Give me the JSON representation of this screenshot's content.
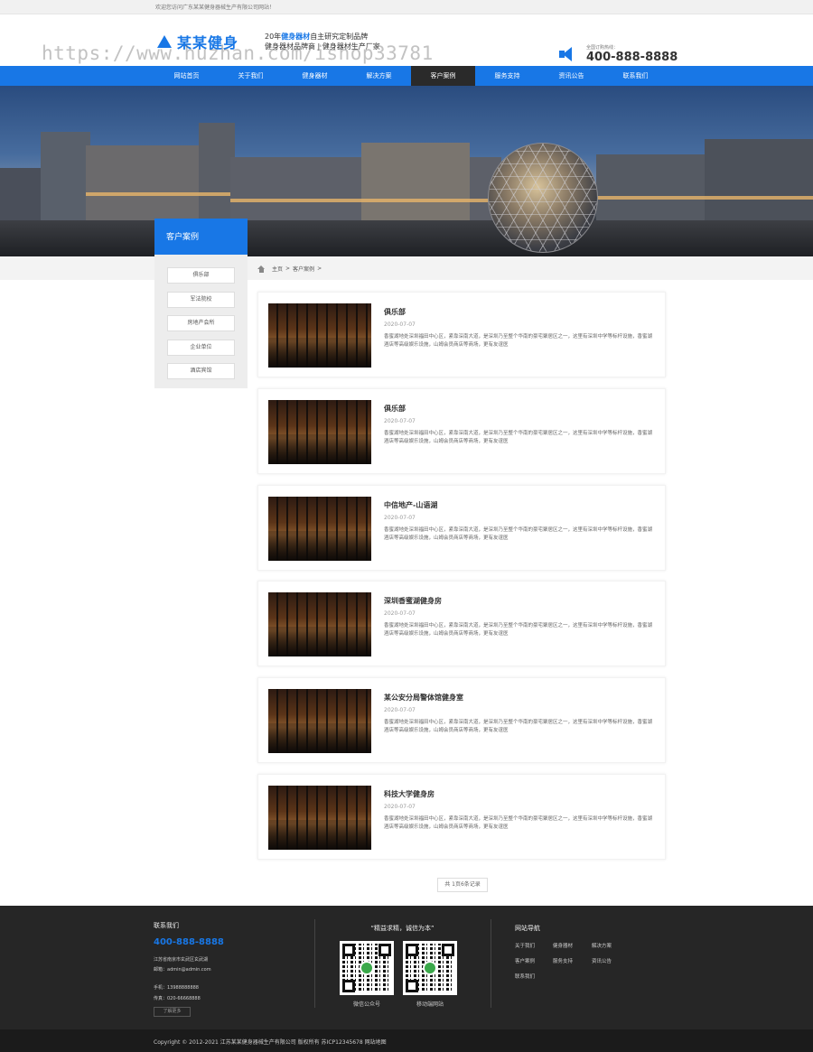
{
  "topbar": {
    "welcome": "欢迎您访问广东某某健身器械生产有限公司网站！"
  },
  "header": {
    "logo_text": "某某健身",
    "slogan_line1_prefix": "20年",
    "slogan_line1_highlight": "健身器材",
    "slogan_line1_suffix": "自主研究定制品牌",
    "slogan_line2": "健身器材品牌商 | 健身器材生产厂家",
    "watermark": "https://www.huzhan.com/ishop33781",
    "hotline_label": "全国订购热线：",
    "hotline_number": "400-888-8888"
  },
  "nav": {
    "items": [
      "网站首页",
      "关于我们",
      "健身器材",
      "解决方案",
      "客户案例",
      "服务支持",
      "资讯公告",
      "联系我们"
    ],
    "active_index": 4
  },
  "breadcrumb": {
    "home": "主页",
    "sep": ">",
    "current": "客户案例",
    "tail": ">"
  },
  "sidebar": {
    "title": "客户案例",
    "items": [
      "俱乐部",
      "军法院校",
      "房地产会所",
      "企业单位",
      "酒店宾馆"
    ]
  },
  "cases": [
    {
      "title": "俱乐部",
      "date": "2020-07-07",
      "desc": "香蜜湖地处深圳福田中心区，紧靠深南大道，是深圳乃至整个华南的豪宅聚居区之一，这里有深圳中学等标杆设施，香蜜湖酒店等高级娱乐设施，山姆会员商店等商场，更有友谊医"
    },
    {
      "title": "俱乐部",
      "date": "2020-07-07",
      "desc": "香蜜湖地处深圳福田中心区，紧靠深南大道，是深圳乃至整个华南的豪宅聚居区之一，这里有深圳中学等标杆设施，香蜜湖酒店等高级娱乐设施，山姆会员商店等商场，更有友谊医"
    },
    {
      "title": "中信地产-山语湖",
      "date": "2020-07-07",
      "desc": "香蜜湖地处深圳福田中心区，紧靠深南大道，是深圳乃至整个华南的豪宅聚居区之一，这里有深圳中学等标杆设施，香蜜湖酒店等高级娱乐设施，山姆会员商店等商场，更有友谊医"
    },
    {
      "title": "深圳香蜜湖健身房",
      "date": "2020-07-07",
      "desc": "香蜜湖地处深圳福田中心区，紧靠深南大道，是深圳乃至整个华南的豪宅聚居区之一，这里有深圳中学等标杆设施，香蜜湖酒店等高级娱乐设施，山姆会员商店等商场，更有友谊医"
    },
    {
      "title": "某公安分局警体馆健身室",
      "date": "2020-07-07",
      "desc": "香蜜湖地处深圳福田中心区，紧靠深南大道，是深圳乃至整个华南的豪宅聚居区之一，这里有深圳中学等标杆设施，香蜜湖酒店等高级娱乐设施，山姆会员商店等商场，更有友谊医"
    },
    {
      "title": "科技大学健身房",
      "date": "2020-07-07",
      "desc": "香蜜湖地处深圳福田中心区，紧靠深南大道，是深圳乃至整个华南的豪宅聚居区之一，这里有深圳中学等标杆设施，香蜜湖酒店等高级娱乐设施，山姆会员商店等商场，更有友谊医"
    }
  ],
  "pager": {
    "text": "共 1页6条记录"
  },
  "footer": {
    "contact_title": "联系我们",
    "phone": "400-888-8888",
    "address": "江苏省南京市玄武区玄武湖",
    "email": "邮箱：admin@admin.com",
    "mobile": "手机：13988888888",
    "fax": "传真：020-66668888",
    "more_button": "了解更多",
    "motto": "“精益求精，诚信为本”",
    "qr_wechat_caption": "微信公众号",
    "qr_mobile_caption": "移动端网站",
    "sitenav_title": "网站导航",
    "sitenav_items": [
      "关于我们",
      "健身器材",
      "解决方案",
      "客户案例",
      "服务支持",
      "资讯公告",
      "联系我们"
    ]
  },
  "copyright": {
    "text": "Copyright © 2012-2021 江苏某某健身器械生产有限公司 版权所有 苏ICP12345678 网站地图"
  },
  "colors": {
    "brand_blue": "#1877e6",
    "footer_bg": "#262626",
    "nav_active": "#2a2a2a"
  }
}
